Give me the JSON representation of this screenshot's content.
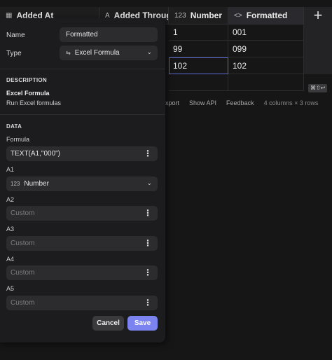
{
  "grid": {
    "columns": [
      {
        "label": "Added At",
        "icon": "calendar-icon"
      },
      {
        "label": "Added Through",
        "icon": "text-icon"
      },
      {
        "label": "Number",
        "icon": "number-icon"
      },
      {
        "label": "Formatted",
        "icon": "code-icon"
      }
    ],
    "rows": [
      [
        "1",
        "001"
      ],
      [
        "99",
        "099"
      ],
      [
        "102",
        "102"
      ]
    ],
    "add_column_label": "+",
    "shortcut": "⌘⇧↩",
    "footer": {
      "export": "Export",
      "show_api": "Show API",
      "feedback": "Feedback",
      "summary": "4 columns × 3 rows"
    },
    "number_icon_text": "123"
  },
  "panel": {
    "name_label": "Name",
    "name_value": "Formatted",
    "type_label": "Type",
    "type_value": "Excel Formula",
    "description_heading": "DESCRIPTION",
    "description_title": "Excel Formula",
    "description_text": "Run Excel formulas",
    "data_heading": "DATA",
    "formula_label": "Formula",
    "formula_value": "TEXT(A1,\"000\")",
    "a1_label": "A1",
    "a1_icon_text": "123",
    "a1_value": "Number",
    "a2_label": "A2",
    "a2_placeholder": "Custom",
    "a3_label": "A3",
    "a3_placeholder": "Custom",
    "a4_label": "A4",
    "a4_placeholder": "Custom",
    "a5_label": "A5",
    "a5_placeholder": "Custom",
    "cancel_label": "Cancel",
    "save_label": "Save"
  }
}
